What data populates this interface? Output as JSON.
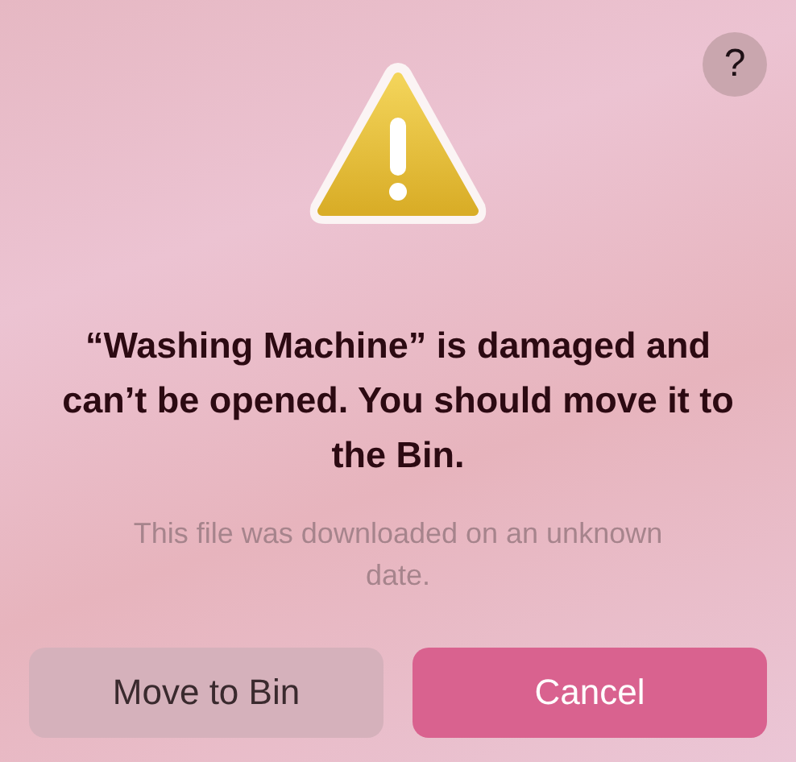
{
  "help_button": {
    "label": "?"
  },
  "title": "“Washing Machine” is damaged and can’t be opened. You should move it to the Bin.",
  "message": "This file was downloaded on an unknown date.",
  "buttons": [
    {
      "label": "Move to Bin",
      "kind": "secondary"
    },
    {
      "label": "Cancel",
      "kind": "primary"
    }
  ]
}
